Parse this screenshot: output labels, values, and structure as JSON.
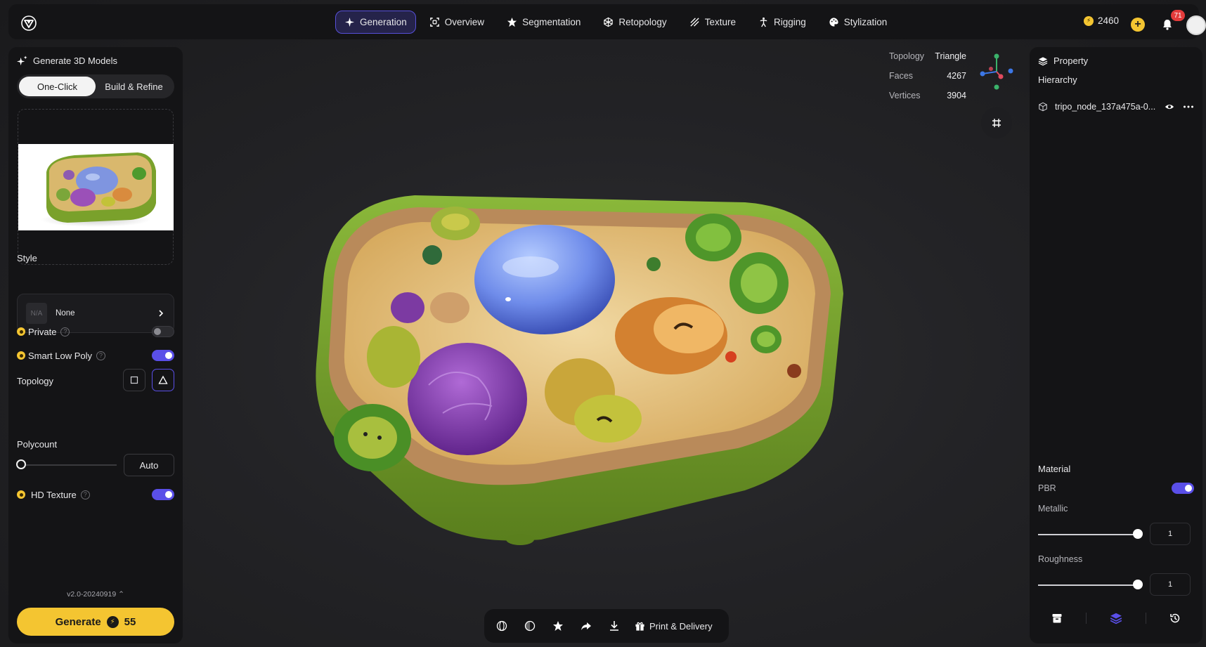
{
  "nav": {
    "tabs": [
      {
        "label": "Generation",
        "icon": "sparkle-icon",
        "active": true
      },
      {
        "label": "Overview",
        "icon": "scan-icon"
      },
      {
        "label": "Segmentation",
        "icon": "segment-icon"
      },
      {
        "label": "Retopology",
        "icon": "mesh-icon"
      },
      {
        "label": "Texture",
        "icon": "texture-icon"
      },
      {
        "label": "Rigging",
        "icon": "figure-icon"
      },
      {
        "label": "Stylization",
        "icon": "palette-icon"
      }
    ],
    "credits": "2460",
    "notifications": "71",
    "accent": "#5a4fe8",
    "coin_color": "#f4c531"
  },
  "left_panel": {
    "title": "Generate 3D Models",
    "modes": [
      "One-Click",
      "Build & Refine"
    ],
    "active_mode": "One-Click",
    "style_label": "Style",
    "style_placeholder": "N/A",
    "style_value": "None",
    "private_label": "Private",
    "private_on": false,
    "smart_low_poly_label": "Smart Low Poly",
    "smart_low_poly_on": true,
    "topology_label": "Topology",
    "polycount_label": "Polycount",
    "polycount_value": "Auto",
    "polycount_fraction": 0,
    "hd_texture_label": "HD Texture",
    "hd_texture_on": true,
    "version": "v2.0-20240919",
    "generate_label": "Generate",
    "generate_cost": "55"
  },
  "viewport": {
    "topology_key": "Topology",
    "topology_val": "Triangle",
    "faces_key": "Faces",
    "faces_val": "4267",
    "vertices_key": "Vertices",
    "vertices_val": "3904"
  },
  "bottom_bar": {
    "print_label": "Print & Delivery"
  },
  "right_panel": {
    "title": "Property",
    "hierarchy_label": "Hierarchy",
    "node_name": "tripo_node_137a475a-0...",
    "material_label": "Material",
    "pbr_label": "PBR",
    "pbr_on": true,
    "metallic_label": "Metallic",
    "metallic_value": "1",
    "roughness_label": "Roughness",
    "roughness_value": "1"
  }
}
